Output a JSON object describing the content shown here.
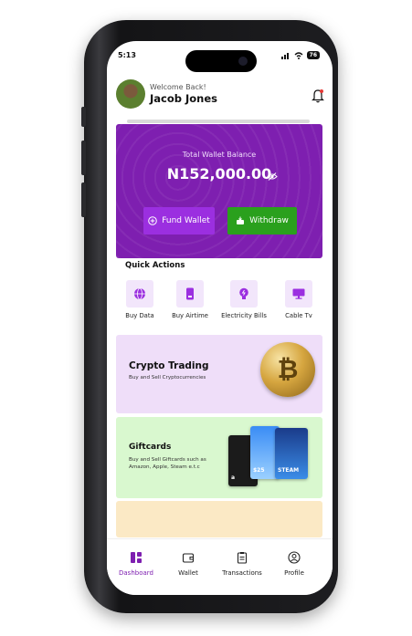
{
  "status_bar": {
    "time": "5:13",
    "battery": "76"
  },
  "header": {
    "welcome": "Welcome Back!",
    "name": "Jacob Jones"
  },
  "wallet": {
    "label": "Total Wallet Balance",
    "balance": "N152,000.00",
    "fund_button": "Fund Wallet",
    "withdraw_button": "Withdraw"
  },
  "quick_actions": {
    "title": "Quick Actions",
    "items": [
      {
        "label": "Buy Data",
        "icon": "globe-icon"
      },
      {
        "label": "Buy Airtime",
        "icon": "phone-icon"
      },
      {
        "label": "Electricity Bills",
        "icon": "bulb-icon"
      },
      {
        "label": "Cable Tv",
        "icon": "tv-icon"
      }
    ]
  },
  "promos": {
    "crypto": {
      "title": "Crypto Trading",
      "subtitle": "Buy and Sell Cryptocurrencies"
    },
    "giftcards": {
      "title": "Giftcards",
      "subtitle": "Buy and Sell Giftcards such as Amazon, Apple, Steam e.t.c"
    }
  },
  "tabs": [
    {
      "label": "Dashboard",
      "active": true
    },
    {
      "label": "Wallet",
      "active": false
    },
    {
      "label": "Transactions",
      "active": false
    },
    {
      "label": "Profile",
      "active": false
    }
  ],
  "colors": {
    "brand_purple": "#7e1fb0",
    "fund_purple": "#9b2fe0",
    "withdraw_green": "#2aa01d"
  }
}
